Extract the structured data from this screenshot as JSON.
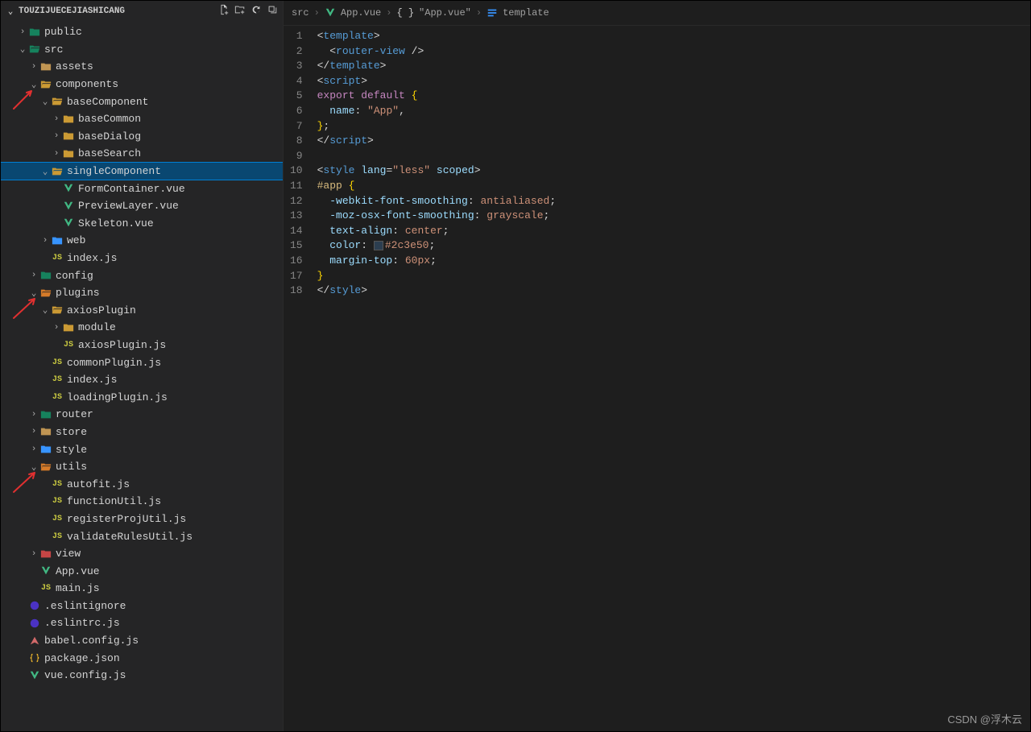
{
  "explorer": {
    "title": "TOUZIJUECEJIASHICANG",
    "actions": [
      "new-file",
      "new-folder",
      "refresh",
      "collapse-all"
    ]
  },
  "tree": [
    {
      "indent": 0,
      "tw": ">",
      "type": "folder",
      "variant": "folder-teal",
      "label": "public"
    },
    {
      "indent": 0,
      "tw": "v",
      "type": "folder",
      "variant": "folder-teal",
      "label": "src"
    },
    {
      "indent": 1,
      "tw": ">",
      "type": "folder",
      "variant": "folder-icon",
      "label": "assets"
    },
    {
      "indent": 1,
      "tw": "v",
      "type": "folder",
      "variant": "folder-yellow",
      "label": "components"
    },
    {
      "indent": 2,
      "tw": "v",
      "type": "folder",
      "variant": "folder-yellow",
      "label": "baseComponent"
    },
    {
      "indent": 3,
      "tw": ">",
      "type": "folder",
      "variant": "folder-yellow",
      "label": "baseCommon"
    },
    {
      "indent": 3,
      "tw": ">",
      "type": "folder",
      "variant": "folder-yellow",
      "label": "baseDialog"
    },
    {
      "indent": 3,
      "tw": ">",
      "type": "folder",
      "variant": "folder-yellow",
      "label": "baseSearch"
    },
    {
      "indent": 2,
      "tw": "v",
      "type": "folder",
      "variant": "folder-yellow",
      "label": "singleComponent",
      "selected": true
    },
    {
      "indent": 3,
      "tw": "",
      "type": "vue",
      "label": "FormContainer.vue"
    },
    {
      "indent": 3,
      "tw": "",
      "type": "vue",
      "label": "PreviewLayer.vue"
    },
    {
      "indent": 3,
      "tw": "",
      "type": "vue",
      "label": "Skeleton.vue"
    },
    {
      "indent": 2,
      "tw": ">",
      "type": "folder",
      "variant": "folder-blue",
      "label": "web"
    },
    {
      "indent": 2,
      "tw": "",
      "type": "js",
      "label": "index.js"
    },
    {
      "indent": 1,
      "tw": ">",
      "type": "folder",
      "variant": "folder-teal",
      "label": "config"
    },
    {
      "indent": 1,
      "tw": "v",
      "type": "folder",
      "variant": "folder-orange",
      "label": "plugins"
    },
    {
      "indent": 2,
      "tw": "v",
      "type": "folder",
      "variant": "folder-yellow",
      "label": "axiosPlugin"
    },
    {
      "indent": 3,
      "tw": ">",
      "type": "folder",
      "variant": "folder-yellow",
      "label": "module"
    },
    {
      "indent": 3,
      "tw": "",
      "type": "js",
      "label": "axiosPlugin.js"
    },
    {
      "indent": 2,
      "tw": "",
      "type": "js",
      "label": "commonPlugin.js"
    },
    {
      "indent": 2,
      "tw": "",
      "type": "js",
      "label": "index.js"
    },
    {
      "indent": 2,
      "tw": "",
      "type": "js",
      "label": "loadingPlugin.js"
    },
    {
      "indent": 1,
      "tw": ">",
      "type": "folder",
      "variant": "folder-teal",
      "label": "router"
    },
    {
      "indent": 1,
      "tw": ">",
      "type": "folder",
      "variant": "folder-icon",
      "label": "store"
    },
    {
      "indent": 1,
      "tw": ">",
      "type": "folder",
      "variant": "folder-blue",
      "label": "style"
    },
    {
      "indent": 1,
      "tw": "v",
      "type": "folder",
      "variant": "folder-orange",
      "label": "utils"
    },
    {
      "indent": 2,
      "tw": "",
      "type": "js",
      "label": "autofit.js"
    },
    {
      "indent": 2,
      "tw": "",
      "type": "js",
      "label": "functionUtil.js"
    },
    {
      "indent": 2,
      "tw": "",
      "type": "js",
      "label": "registerProjUtil.js"
    },
    {
      "indent": 2,
      "tw": "",
      "type": "js",
      "label": "validateRulesUtil.js"
    },
    {
      "indent": 1,
      "tw": ">",
      "type": "folder",
      "variant": "folder-red",
      "label": "view"
    },
    {
      "indent": 1,
      "tw": "",
      "type": "vue",
      "label": "App.vue"
    },
    {
      "indent": 1,
      "tw": "",
      "type": "js",
      "label": "main.js"
    },
    {
      "indent": 0,
      "tw": "",
      "type": "eslint",
      "label": ".eslintignore"
    },
    {
      "indent": 0,
      "tw": "",
      "type": "eslint",
      "label": ".eslintrc.js"
    },
    {
      "indent": 0,
      "tw": "",
      "type": "babel",
      "label": "babel.config.js"
    },
    {
      "indent": 0,
      "tw": "",
      "type": "json",
      "label": "package.json"
    },
    {
      "indent": 0,
      "tw": "",
      "type": "vue",
      "label": "vue.config.js"
    }
  ],
  "breadcrumb": {
    "parts": [
      "src",
      "App.vue",
      "\"App.vue\"",
      "template"
    ]
  },
  "code": {
    "lines": [
      {
        "n": 1,
        "html": "<span class='d'>&lt;</span><span class='t'>template</span><span class='d'>&gt;</span>"
      },
      {
        "n": 2,
        "html": "  <span class='d'>&lt;</span><span class='t'>router-view</span> <span class='d'>/&gt;</span>"
      },
      {
        "n": 3,
        "html": "<span class='d'>&lt;/</span><span class='t'>template</span><span class='d'>&gt;</span>"
      },
      {
        "n": 4,
        "html": "<span class='d'>&lt;</span><span class='t'>script</span><span class='d'>&gt;</span>"
      },
      {
        "n": 5,
        "html": "<span class='k'>export</span> <span class='k'>default</span> <span class='b'>{</span>"
      },
      {
        "n": 6,
        "html": "  <span class='p'>name</span><span class='d'>:</span> <span class='s'>\"App\"</span><span class='d'>,</span>"
      },
      {
        "n": 7,
        "html": "<span class='b'>}</span><span class='d'>;</span>"
      },
      {
        "n": 8,
        "html": "<span class='d'>&lt;/</span><span class='t'>script</span><span class='d'>&gt;</span>"
      },
      {
        "n": 9,
        "html": ""
      },
      {
        "n": 10,
        "html": "<span class='d'>&lt;</span><span class='t'>style</span> <span class='a'>lang</span><span class='d'>=</span><span class='s'>\"less\"</span> <span class='a'>scoped</span><span class='d'>&gt;</span>"
      },
      {
        "n": 11,
        "html": "<span class='sel'>#app</span> <span class='b'>{</span>"
      },
      {
        "n": 12,
        "html": "  <span class='p'>-webkit-font-smoothing</span><span class='d'>:</span> <span class='s'>antialiased</span><span class='d'>;</span>"
      },
      {
        "n": 13,
        "html": "  <span class='p'>-moz-osx-font-smoothing</span><span class='d'>:</span> <span class='s'>grayscale</span><span class='d'>;</span>"
      },
      {
        "n": 14,
        "html": "  <span class='p'>text-align</span><span class='d'>:</span> <span class='s'>center</span><span class='d'>;</span>"
      },
      {
        "n": 15,
        "html": "  <span class='p'>color</span><span class='d'>:</span> <span class='swatch'></span><span class='s'>#2c3e50</span><span class='d'>;</span>"
      },
      {
        "n": 16,
        "html": "  <span class='p'>margin-top</span><span class='d'>:</span> <span class='s'>60px</span><span class='d'>;</span>"
      },
      {
        "n": 17,
        "html": "<span class='b'>}</span>"
      },
      {
        "n": 18,
        "html": "<span class='d'>&lt;/</span><span class='t'>style</span><span class='d'>&gt;</span>"
      }
    ]
  },
  "watermark": "CSDN @浮木云"
}
